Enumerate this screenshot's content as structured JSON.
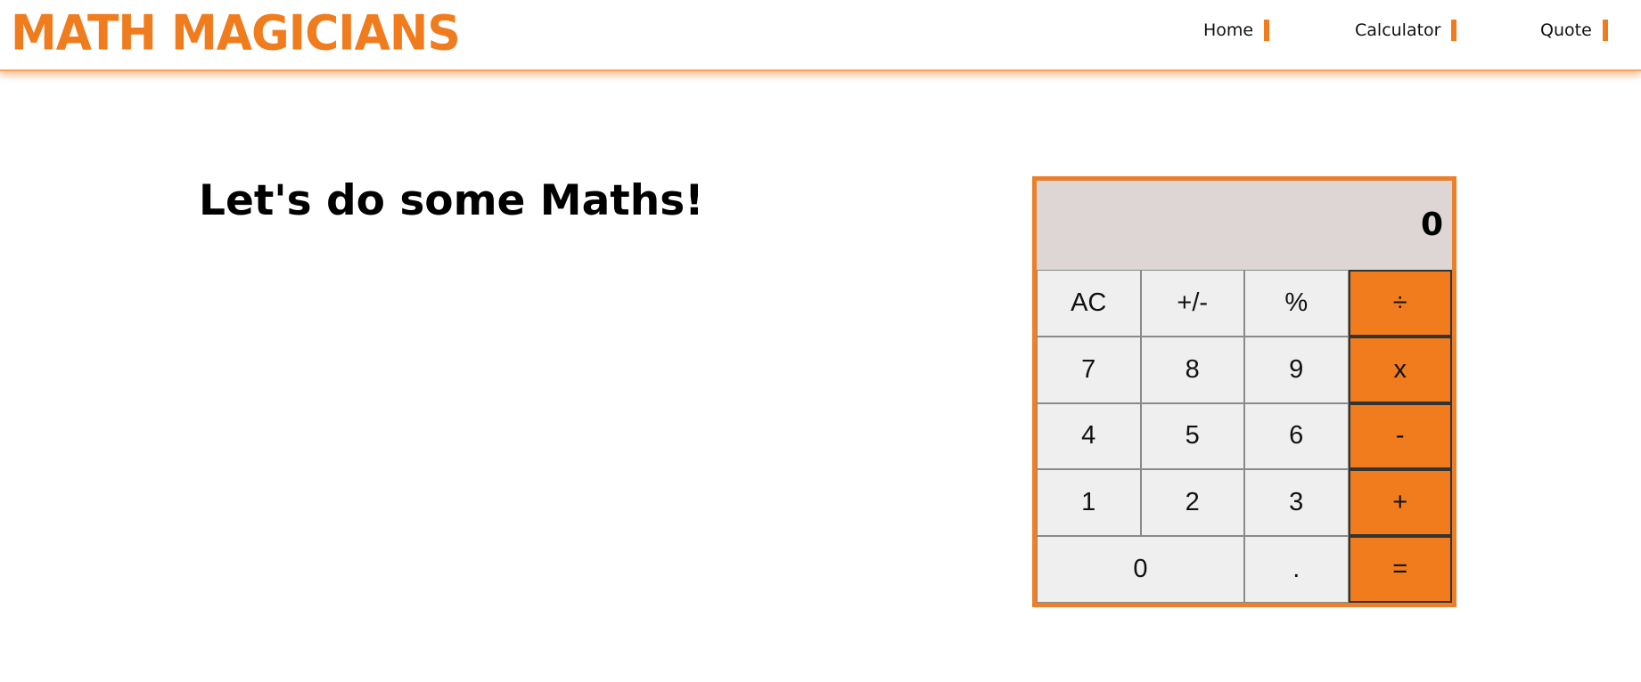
{
  "header": {
    "logo": "MATH MAGICIANS",
    "nav": [
      {
        "label": "Home"
      },
      {
        "label": "Calculator"
      },
      {
        "label": "Quote"
      }
    ]
  },
  "main": {
    "title": "Let's do some Maths!"
  },
  "calculator": {
    "display": "0",
    "keys": {
      "ac": "AC",
      "sign": "+/-",
      "percent": "%",
      "divide": "÷",
      "seven": "7",
      "eight": "8",
      "nine": "9",
      "multiply": "x",
      "four": "4",
      "five": "5",
      "six": "6",
      "minus": "-",
      "one": "1",
      "two": "2",
      "three": "3",
      "plus": "+",
      "zero": "0",
      "dot": ".",
      "equals": "="
    }
  },
  "colors": {
    "accent": "#f07c1e",
    "display_bg": "#ded5d5",
    "key_bg": "#efefef"
  }
}
